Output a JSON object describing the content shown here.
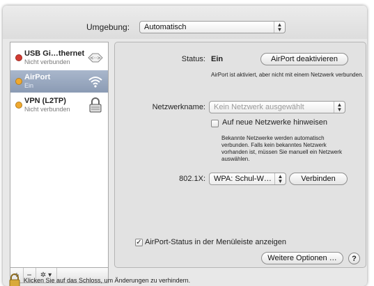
{
  "environment": {
    "label": "Umgebung:",
    "value": "Automatisch"
  },
  "services": [
    {
      "name": "USB Gi…thernet",
      "status": "Nicht verbunden",
      "dot_color": "#d23b32",
      "icon": "ethernet-icon",
      "selected": false
    },
    {
      "name": "AirPort",
      "status": "Ein",
      "dot_color": "#f0a92e",
      "icon": "wifi-icon",
      "selected": true
    },
    {
      "name": "VPN (L2TP)",
      "status": "Nicht verbunden",
      "dot_color": "#f0a92e",
      "icon": "vpn-lock-icon",
      "selected": false
    }
  ],
  "toolbar": {
    "add": "+",
    "remove": "−",
    "gear": "✲ ▾"
  },
  "detail": {
    "status_label": "Status:",
    "status_value": "Ein",
    "toggle_button": "AirPort deaktivieren",
    "status_note": "AirPort ist aktiviert, aber nicht mit einem Netzwerk verbunden.",
    "network_label": "Netzwerkname:",
    "network_placeholder": "Kein Netzwerk ausgewählt",
    "ask_join_label": "Auf neue Netzwerke hinweisen",
    "ask_join_checked": false,
    "ask_join_note": "Bekannte Netzwerke werden automatisch verbunden. Falls kein bekanntes Netzwerk vorhanden ist, müssen Sie manuell ein Netzwerk auswählen.",
    "auth_label": "802.1X:",
    "auth_value": "WPA: Schul-W…",
    "connect_button": "Verbinden",
    "menubar_label": "AirPort-Status in der Menüleiste anzeigen",
    "menubar_checked": true,
    "advanced_button": "Weitere Optionen …",
    "help": "?"
  },
  "lock": {
    "text": "Klicken Sie auf das Schloss, um Änderungen zu verhindern."
  },
  "colors": {
    "selection": "#98a8c0",
    "panel": "#e2e2e2",
    "window": "#e8e8e8"
  }
}
